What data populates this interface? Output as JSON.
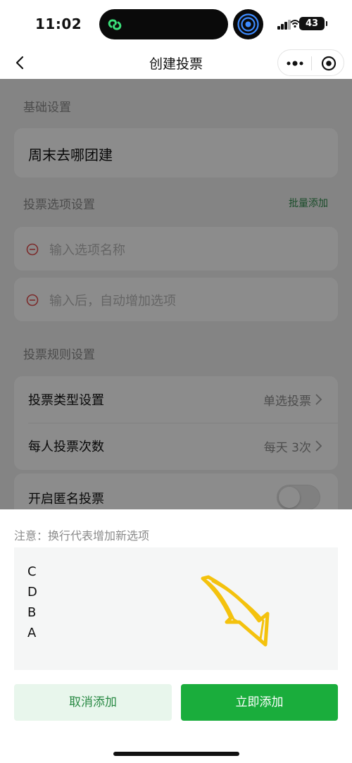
{
  "status_bar": {
    "time": "11:02",
    "battery": "43"
  },
  "nav": {
    "title": "创建投票"
  },
  "form": {
    "basic_section": "基础设置",
    "vote_title": "周末去哪团建",
    "options_section": "投票选项设置",
    "batch_add": "批量添加",
    "option_placeholders": [
      "输入选项名称",
      "输入后，自动增加选项"
    ],
    "rules_section": "投票规则设置",
    "rules": [
      {
        "label": "投票类型设置",
        "value": "单选投票"
      },
      {
        "label": "每人投票次数",
        "value": "每天 3次"
      }
    ],
    "anonymous": {
      "label": "开启匿名投票",
      "enabled": false
    }
  },
  "sheet": {
    "note": "注意：换行代表增加新选项",
    "lines": [
      "C",
      "D",
      "B",
      "A"
    ],
    "cancel_label": "取消添加",
    "add_label": "立即添加"
  },
  "colors": {
    "accent": "#1aad3c",
    "danger": "#e25050",
    "arrow": "#f4c20d"
  },
  "icons": [
    "back-icon",
    "more-icon",
    "target-icon",
    "remove-option-icon",
    "chevron-right-icon",
    "arrow-doodle-icon"
  ]
}
